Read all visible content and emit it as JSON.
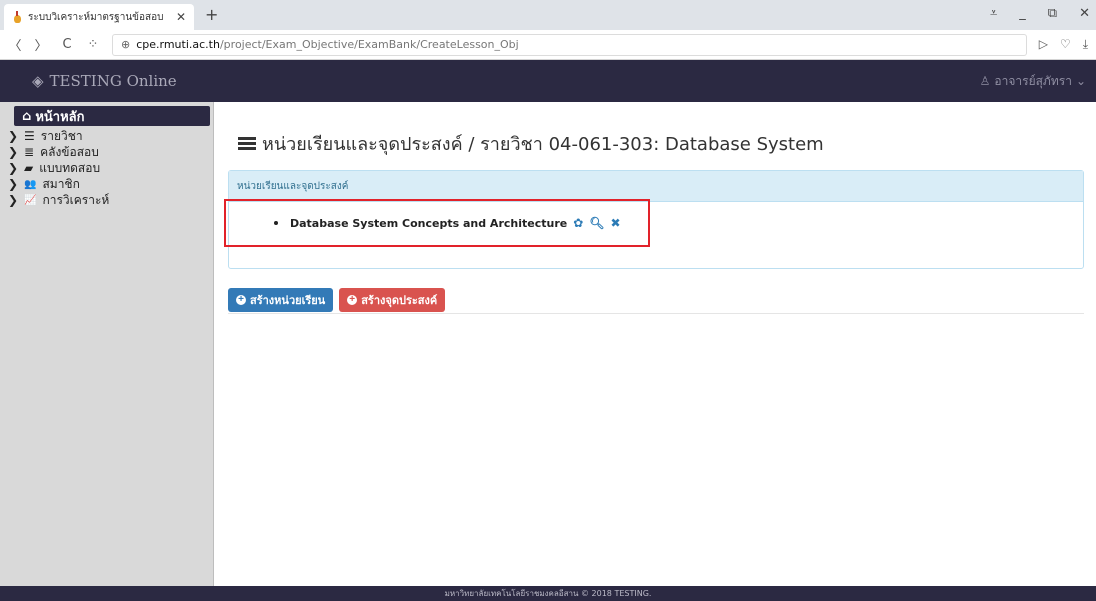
{
  "browser": {
    "tab_title": "ระบบวิเคราะห์มาตรฐานข้อสอบ",
    "tab_close": "✕",
    "new_tab": "+",
    "url_host": "cpe.rmuti.ac.th",
    "url_path": "/project/Exam_Objective/ExamBank/CreateLesson_Obj",
    "back": "〈",
    "forward": "〉",
    "reload": "C",
    "apps": "⁘"
  },
  "header": {
    "brand": "TESTING Online",
    "user": "อาจารย์สุภัทรา"
  },
  "sidebar": {
    "home": "หน้าหลัก",
    "items": [
      {
        "icon": "list-icon",
        "label": "รายวิชา",
        "glyph": "☰"
      },
      {
        "icon": "database-icon",
        "label": "คลังข้อสอบ",
        "glyph": "≣"
      },
      {
        "icon": "book-icon",
        "label": "แบบทดสอบ",
        "glyph": "▰"
      },
      {
        "icon": "users-icon",
        "label": "สมาชิก",
        "glyph": "👥"
      },
      {
        "icon": "chart-icon",
        "label": "การวิเคราะห์",
        "glyph": "📈"
      }
    ]
  },
  "main": {
    "title": "หน่วยเรียนและจุดประสงค์ / รายวิชา 04-061-303: Database System",
    "panel_heading": "หน่วยเรียนและจุดประสงค์",
    "lessons": [
      {
        "label": "Database System Concepts and Architecture"
      }
    ],
    "buttons": {
      "create_lesson": "สร้างหน่วยเรียน",
      "create_objective": "สร้างจุดประสงค์"
    }
  },
  "footer": {
    "text": "มหาวิทยาลัยเทคโนโลยีราชมงคลอีสาน © 2018 TESTING."
  },
  "colors": {
    "header_bg": "#2b2942",
    "panel_head_bg": "#d9edf7",
    "primary": "#337ab7",
    "danger": "#d9534f",
    "highlight": "#e2222a"
  }
}
